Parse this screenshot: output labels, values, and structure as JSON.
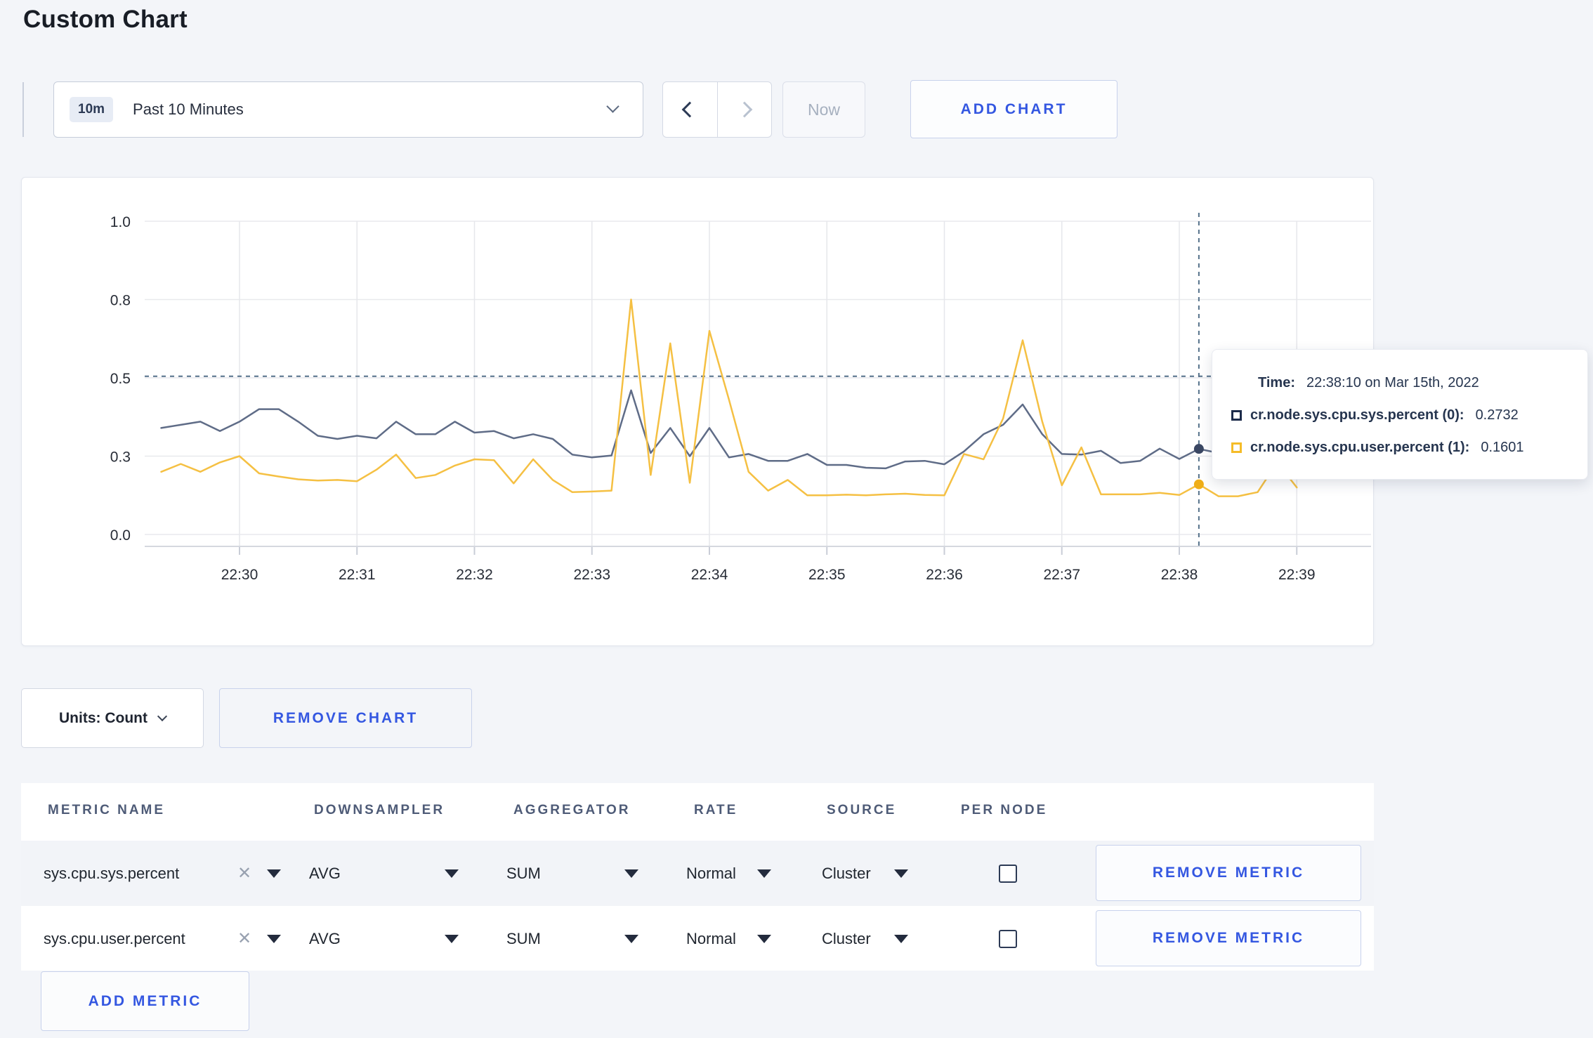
{
  "page": {
    "title": "Custom Chart"
  },
  "toolbar": {
    "range_badge": "10m",
    "range_label": "Past 10 Minutes",
    "now_label": "Now",
    "add_chart_label": "ADD CHART"
  },
  "colors": {
    "accent_blue": "#3457e1",
    "page_background": "#f3f5f9",
    "series_sys": "#5f6c87",
    "series_user": "#f5c043",
    "crosshair": "#54718a"
  },
  "chart_data": {
    "type": "line",
    "title": "",
    "xlabel": "",
    "ylabel": "",
    "grid": true,
    "legend_position": "tooltip-only",
    "x_tick_labels": [
      "22:30",
      "22:31",
      "22:32",
      "22:33",
      "22:34",
      "22:35",
      "22:36",
      "22:37",
      "22:38",
      "22:39"
    ],
    "y_ticks": [
      {
        "at": 0.0,
        "label": "0.0"
      },
      {
        "at": 0.25,
        "label": "0.3"
      },
      {
        "at": 0.5,
        "label": "0.5"
      },
      {
        "at": 0.75,
        "label": "0.8"
      },
      {
        "at": 1.0,
        "label": "1.0"
      }
    ],
    "y_domain": [
      0,
      1
    ],
    "x_domain_seconds_rel_2230": [
      -48,
      580
    ],
    "sample_interval_seconds": 10,
    "crosshair": {
      "t": 490,
      "time": "22:38:10",
      "mouse_value": 0.505
    },
    "series": [
      {
        "name": "cr.node.sys.cpu.sys.percent (0)",
        "color": "#5f6c87",
        "dot_color": "#3a4763",
        "marker_color": "#1c2b4a",
        "value_at_crosshair": 0.2732,
        "points": [
          [
            -40,
            0.34
          ],
          [
            -30,
            0.35
          ],
          [
            -20,
            0.36
          ],
          [
            -10,
            0.33
          ],
          [
            0,
            0.36
          ],
          [
            10,
            0.4
          ],
          [
            20,
            0.4
          ],
          [
            30,
            0.36
          ],
          [
            40,
            0.315
          ],
          [
            50,
            0.305
          ],
          [
            60,
            0.315
          ],
          [
            70,
            0.307
          ],
          [
            80,
            0.36
          ],
          [
            90,
            0.32
          ],
          [
            100,
            0.32
          ],
          [
            110,
            0.36
          ],
          [
            120,
            0.325
          ],
          [
            130,
            0.33
          ],
          [
            140,
            0.307
          ],
          [
            150,
            0.32
          ],
          [
            160,
            0.305
          ],
          [
            170,
            0.255
          ],
          [
            180,
            0.246
          ],
          [
            190,
            0.252
          ],
          [
            200,
            0.46
          ],
          [
            210,
            0.26
          ],
          [
            220,
            0.34
          ],
          [
            230,
            0.25
          ],
          [
            240,
            0.34
          ],
          [
            250,
            0.246
          ],
          [
            260,
            0.257
          ],
          [
            270,
            0.235
          ],
          [
            280,
            0.235
          ],
          [
            290,
            0.257
          ],
          [
            300,
            0.222
          ],
          [
            310,
            0.222
          ],
          [
            320,
            0.213
          ],
          [
            330,
            0.211
          ],
          [
            340,
            0.233
          ],
          [
            350,
            0.235
          ],
          [
            360,
            0.224
          ],
          [
            370,
            0.265
          ],
          [
            380,
            0.32
          ],
          [
            390,
            0.35
          ],
          [
            400,
            0.415
          ],
          [
            410,
            0.32
          ],
          [
            420,
            0.257
          ],
          [
            430,
            0.255
          ],
          [
            440,
            0.267
          ],
          [
            450,
            0.228
          ],
          [
            460,
            0.235
          ],
          [
            470,
            0.274
          ],
          [
            480,
            0.241
          ],
          [
            490,
            0.2732
          ],
          [
            500,
            0.26
          ]
        ]
      },
      {
        "name": "cr.node.sys.cpu.user.percent (1)",
        "color": "#f5c043",
        "dot_color": "#efae17",
        "marker_color": "#f5bc28",
        "value_at_crosshair": 0.1601,
        "points": [
          [
            -40,
            0.2
          ],
          [
            -30,
            0.225
          ],
          [
            -20,
            0.2
          ],
          [
            -10,
            0.23
          ],
          [
            0,
            0.25
          ],
          [
            10,
            0.195
          ],
          [
            20,
            0.185
          ],
          [
            30,
            0.176
          ],
          [
            40,
            0.172
          ],
          [
            50,
            0.174
          ],
          [
            60,
            0.17
          ],
          [
            70,
            0.207
          ],
          [
            80,
            0.255
          ],
          [
            90,
            0.18
          ],
          [
            100,
            0.19
          ],
          [
            110,
            0.22
          ],
          [
            120,
            0.24
          ],
          [
            130,
            0.237
          ],
          [
            140,
            0.163
          ],
          [
            150,
            0.24
          ],
          [
            160,
            0.174
          ],
          [
            170,
            0.135
          ],
          [
            180,
            0.137
          ],
          [
            190,
            0.14
          ],
          [
            200,
            0.75
          ],
          [
            210,
            0.19
          ],
          [
            220,
            0.61
          ],
          [
            230,
            0.165
          ],
          [
            240,
            0.65
          ],
          [
            250,
            0.43
          ],
          [
            260,
            0.2
          ],
          [
            270,
            0.14
          ],
          [
            280,
            0.174
          ],
          [
            290,
            0.125
          ],
          [
            300,
            0.125
          ],
          [
            310,
            0.127
          ],
          [
            320,
            0.125
          ],
          [
            330,
            0.128
          ],
          [
            340,
            0.13
          ],
          [
            350,
            0.126
          ],
          [
            360,
            0.125
          ],
          [
            370,
            0.257
          ],
          [
            380,
            0.24
          ],
          [
            390,
            0.37
          ],
          [
            400,
            0.62
          ],
          [
            410,
            0.36
          ],
          [
            420,
            0.157
          ],
          [
            430,
            0.278
          ],
          [
            440,
            0.128
          ],
          [
            450,
            0.128
          ],
          [
            460,
            0.128
          ],
          [
            470,
            0.133
          ],
          [
            480,
            0.126
          ],
          [
            490,
            0.1601
          ],
          [
            500,
            0.122
          ],
          [
            510,
            0.122
          ],
          [
            520,
            0.135
          ],
          [
            530,
            0.23
          ],
          [
            540,
            0.15
          ]
        ]
      }
    ]
  },
  "tooltip": {
    "time_label": "Time:",
    "time_value": "22:38:10 on Mar 15th, 2022",
    "series": [
      {
        "label": "cr.node.sys.cpu.sys.percent (0):",
        "value": "0.2732"
      },
      {
        "label": "cr.node.sys.cpu.user.percent (1):",
        "value": "0.1601"
      }
    ]
  },
  "chart_controls": {
    "units_label": "Units: Count",
    "remove_chart_label": "REMOVE CHART"
  },
  "metrics_table": {
    "headers": [
      "METRIC NAME",
      "DOWNSAMPLER",
      "AGGREGATOR",
      "RATE",
      "SOURCE",
      "PER NODE"
    ],
    "rows": [
      {
        "metric": "sys.cpu.sys.percent",
        "downsampler": "AVG",
        "aggregator": "SUM",
        "rate": "Normal",
        "source": "Cluster",
        "per_node_checked": false,
        "remove_label": "REMOVE METRIC"
      },
      {
        "metric": "sys.cpu.user.percent",
        "downsampler": "AVG",
        "aggregator": "SUM",
        "rate": "Normal",
        "source": "Cluster",
        "per_node_checked": false,
        "remove_label": "REMOVE METRIC"
      }
    ],
    "add_metric_label": "ADD METRIC"
  }
}
